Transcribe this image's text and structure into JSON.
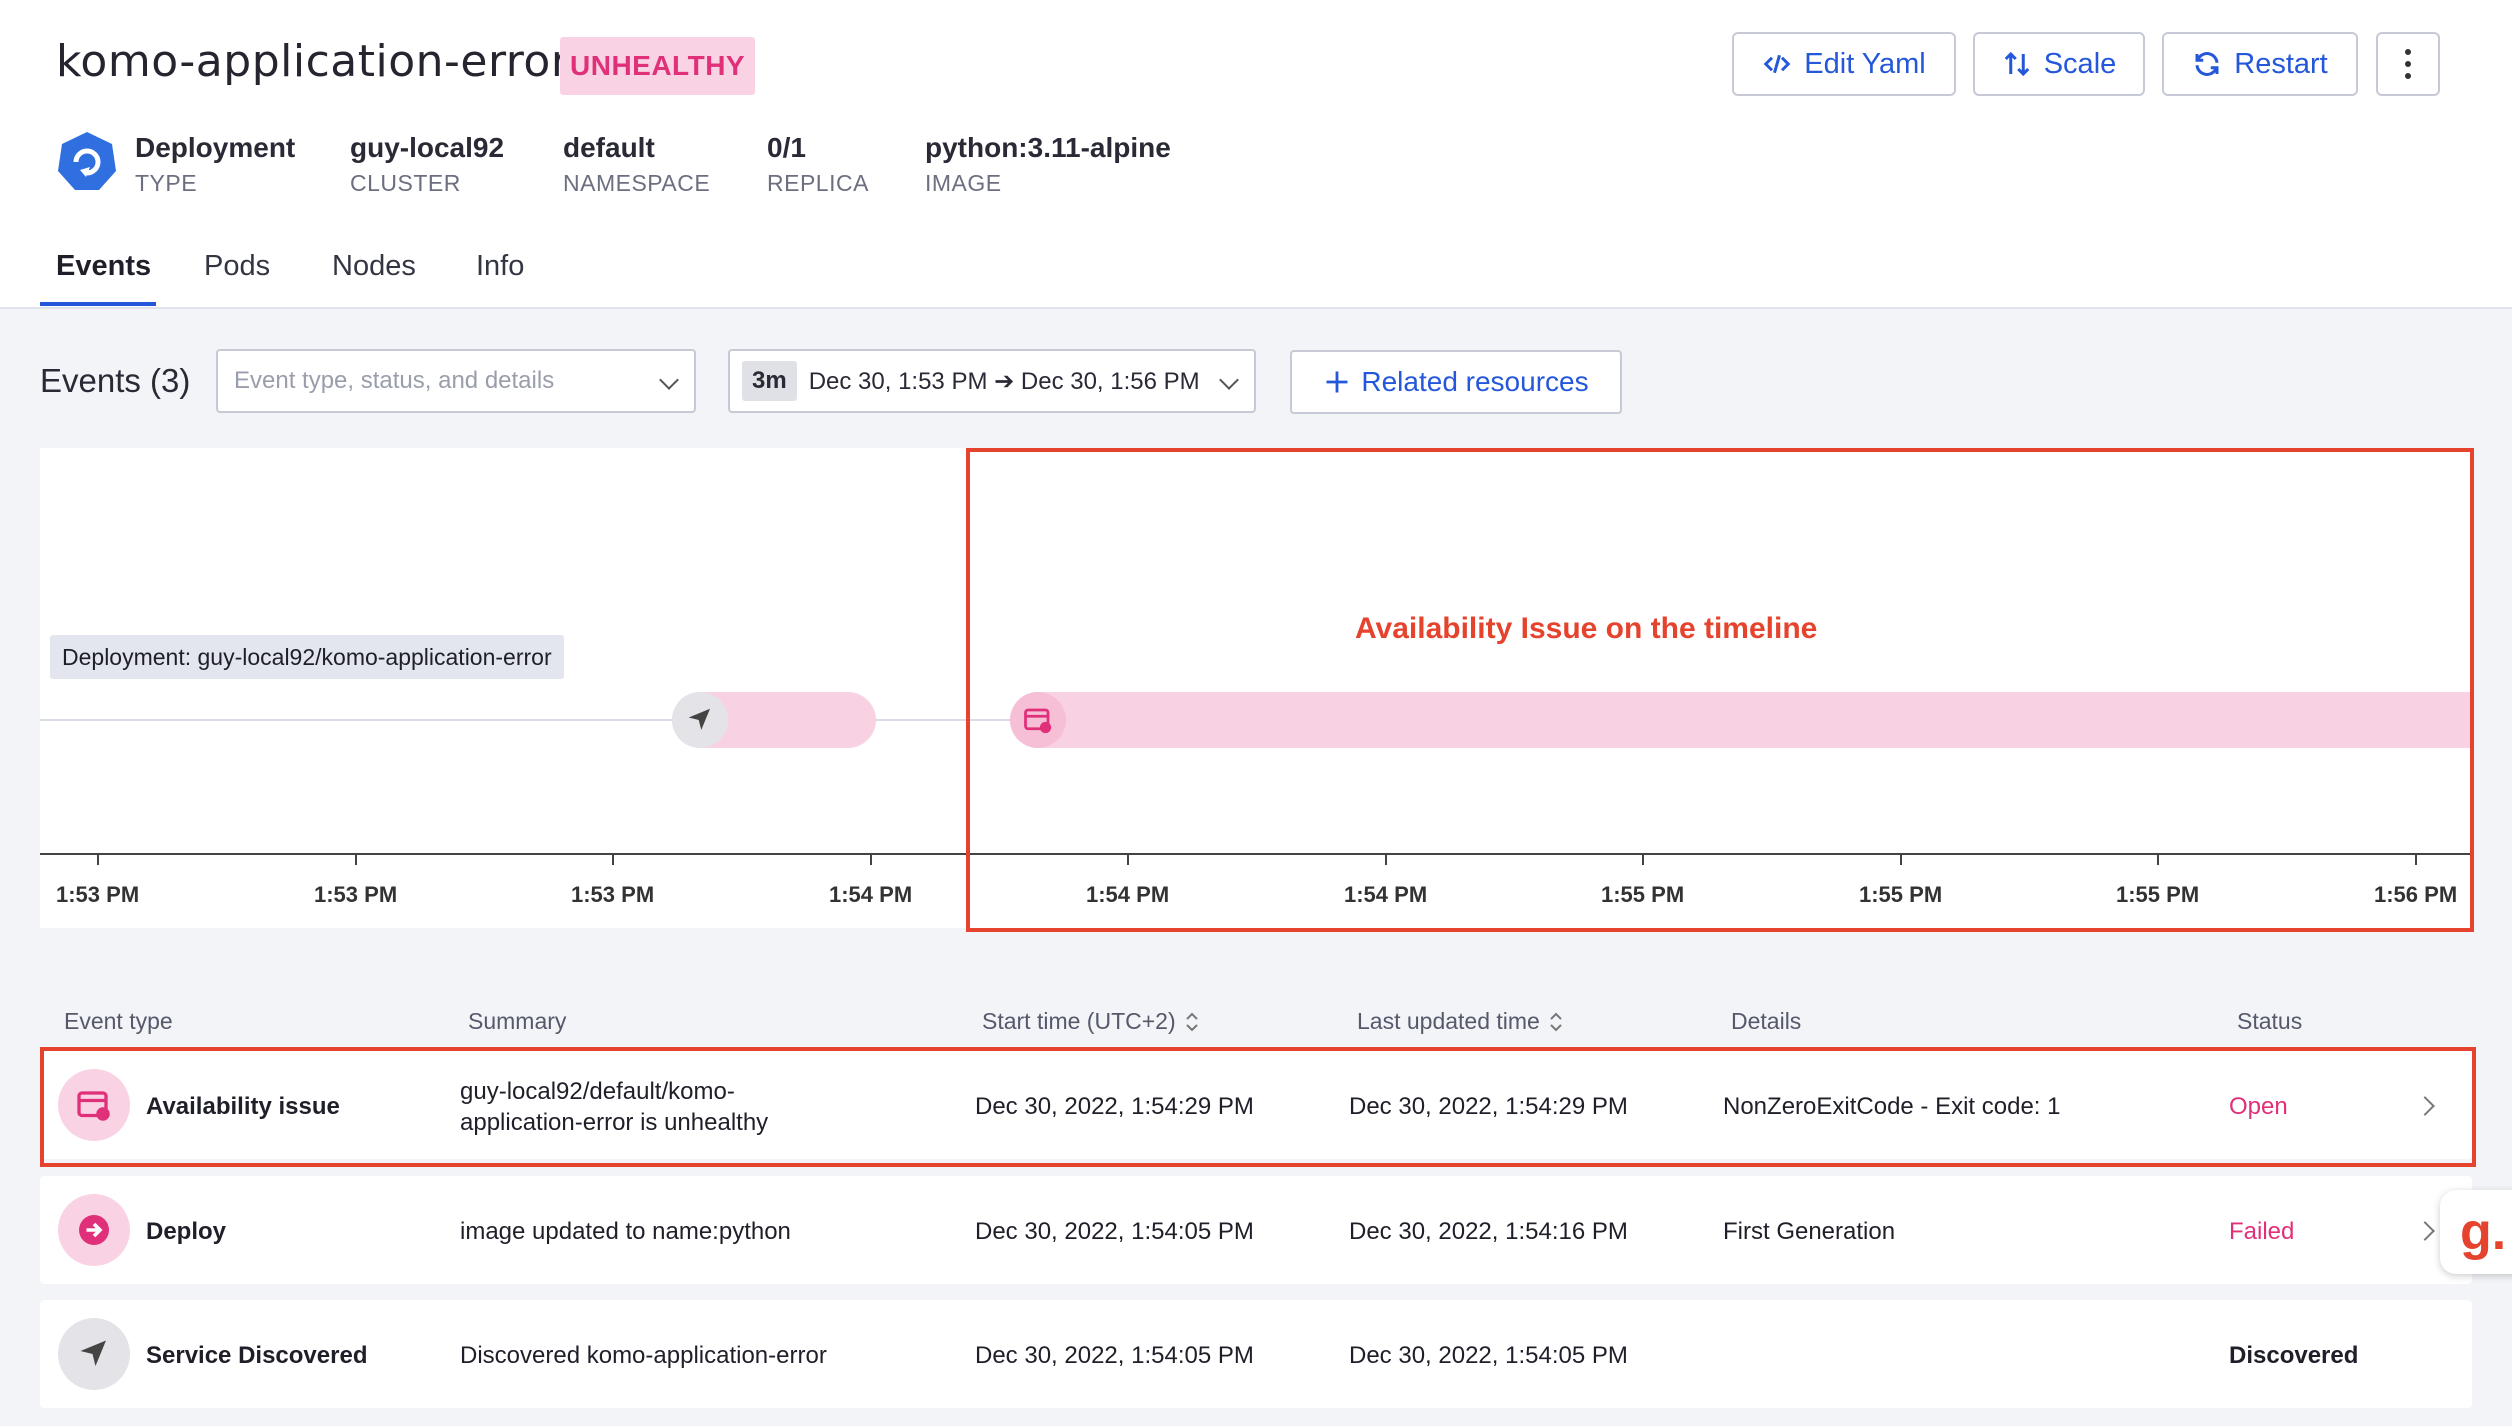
{
  "header": {
    "title": "komo-application-error",
    "status_badge": "UNHEALTHY",
    "buttons": {
      "edit_yaml": "Edit Yaml",
      "scale": "Scale",
      "restart": "Restart"
    }
  },
  "meta": [
    {
      "value": "Deployment",
      "label": "TYPE"
    },
    {
      "value": "guy-local92",
      "label": "CLUSTER"
    },
    {
      "value": "default",
      "label": "NAMESPACE"
    },
    {
      "value": "0/1",
      "label": "REPLICA"
    },
    {
      "value": "python:3.11-alpine",
      "label": "IMAGE"
    }
  ],
  "tabs": [
    "Events",
    "Pods",
    "Nodes",
    "Info"
  ],
  "events": {
    "title": "Events (3)",
    "filter_placeholder": "Event type, status, and details",
    "range_tag": "3m",
    "range_text": "Dec 30, 1:53 PM ➔ Dec 30, 1:56 PM",
    "related_resources": "Related resources"
  },
  "timeline": {
    "resource_label": "Deployment: guy-local92/komo-application-error",
    "annotation": "Availability Issue on the timeline",
    "ticks": [
      "1:53 PM",
      "1:53 PM",
      "1:53 PM",
      "1:54 PM",
      "1:54 PM",
      "1:54 PM",
      "1:55 PM",
      "1:55 PM",
      "1:55 PM",
      "1:56 PM"
    ]
  },
  "table": {
    "headers": [
      "Event type",
      "Summary",
      "Start time (UTC+2)",
      "Last updated time",
      "Details",
      "Status"
    ],
    "rows": [
      {
        "type": "Availability issue",
        "summary_line1": "guy-local92/default/komo-",
        "summary_line2": "application-error is unhealthy",
        "start": "Dec 30, 2022, 1:54:29 PM",
        "updated": "Dec 30, 2022, 1:54:29 PM",
        "details": "NonZeroExitCode - Exit code: 1",
        "status": "Open"
      },
      {
        "type": "Deploy",
        "summary_line1": "image updated to name:python",
        "summary_line2": "",
        "start": "Dec 30, 2022, 1:54:05 PM",
        "updated": "Dec 30, 2022, 1:54:16 PM",
        "details": "First Generation",
        "status": "Failed"
      },
      {
        "type": "Service Discovered",
        "summary_line1": "Discovered komo-application-error",
        "summary_line2": "",
        "start": "Dec 30, 2022, 1:54:05 PM",
        "updated": "Dec 30, 2022, 1:54:05 PM",
        "details": "",
        "status": "Discovered"
      }
    ]
  },
  "fab_label": "g.",
  "colors": {
    "accent": "#2457d9",
    "unhealthy": "#e0307a",
    "annotation": "#e5432e"
  }
}
